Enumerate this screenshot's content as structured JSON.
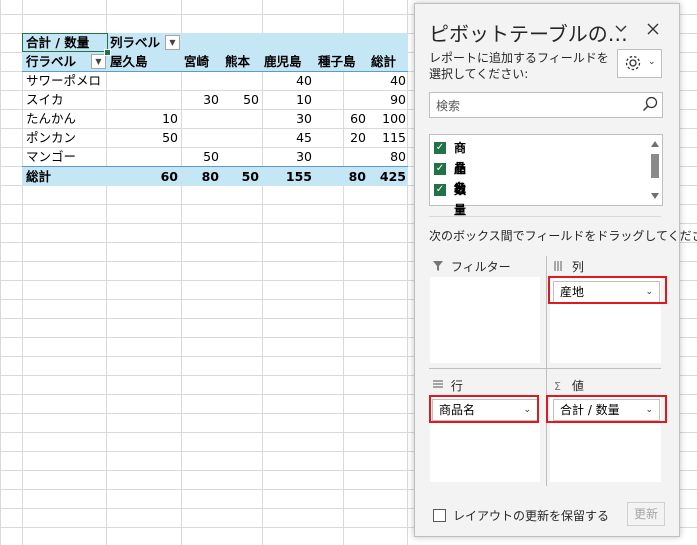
{
  "pivot": {
    "corner_label": "合計 / 数量",
    "col_label": "列ラベル",
    "row_label": "行ラベル",
    "columns": [
      "屋久島",
      "宮崎",
      "熊本",
      "鹿児島",
      "種子島",
      "総計"
    ],
    "rows": [
      {
        "name": "サワーポメロ",
        "values": [
          "",
          "",
          "",
          "40",
          "",
          "40"
        ]
      },
      {
        "name": "スイカ",
        "values": [
          "",
          "30",
          "50",
          "10",
          "",
          "90"
        ]
      },
      {
        "name": "たんかん",
        "values": [
          "10",
          "",
          "",
          "30",
          "60",
          "100"
        ]
      },
      {
        "name": "ポンカン",
        "values": [
          "50",
          "",
          "",
          "45",
          "20",
          "115"
        ]
      },
      {
        "name": "マンゴー",
        "values": [
          "",
          "50",
          "",
          "30",
          "",
          "80"
        ]
      }
    ],
    "total": {
      "name": "総計",
      "values": [
        "60",
        "80",
        "50",
        "155",
        "80",
        "425"
      ]
    }
  },
  "pane": {
    "title": "ピボットテーブルの…",
    "subtitle": "レポートに追加するフィールドを選択してください:",
    "search_placeholder": "検索",
    "fields": [
      {
        "label": "商品名",
        "checked": true
      },
      {
        "label": "産地",
        "checked": true
      },
      {
        "label": "数量",
        "checked": true
      }
    ],
    "drag_hint": "次のボックス間でフィールドをドラッグしてください:",
    "areas": {
      "filter": {
        "title": "フィルター",
        "icon": "filter-icon"
      },
      "columns": {
        "title": "列",
        "icon": "columns-icon",
        "chip": "産地"
      },
      "rows": {
        "title": "行",
        "icon": "rows-icon",
        "chip": "商品名"
      },
      "values": {
        "title": "値",
        "icon": "sigma-icon",
        "chip": "合計 / 数量"
      }
    },
    "defer_label": "レイアウトの更新を保留する",
    "update_label": "更新"
  },
  "colors": {
    "accent": "#217346",
    "highlight": "#c5e6f5",
    "redbox": "#e0191f"
  }
}
